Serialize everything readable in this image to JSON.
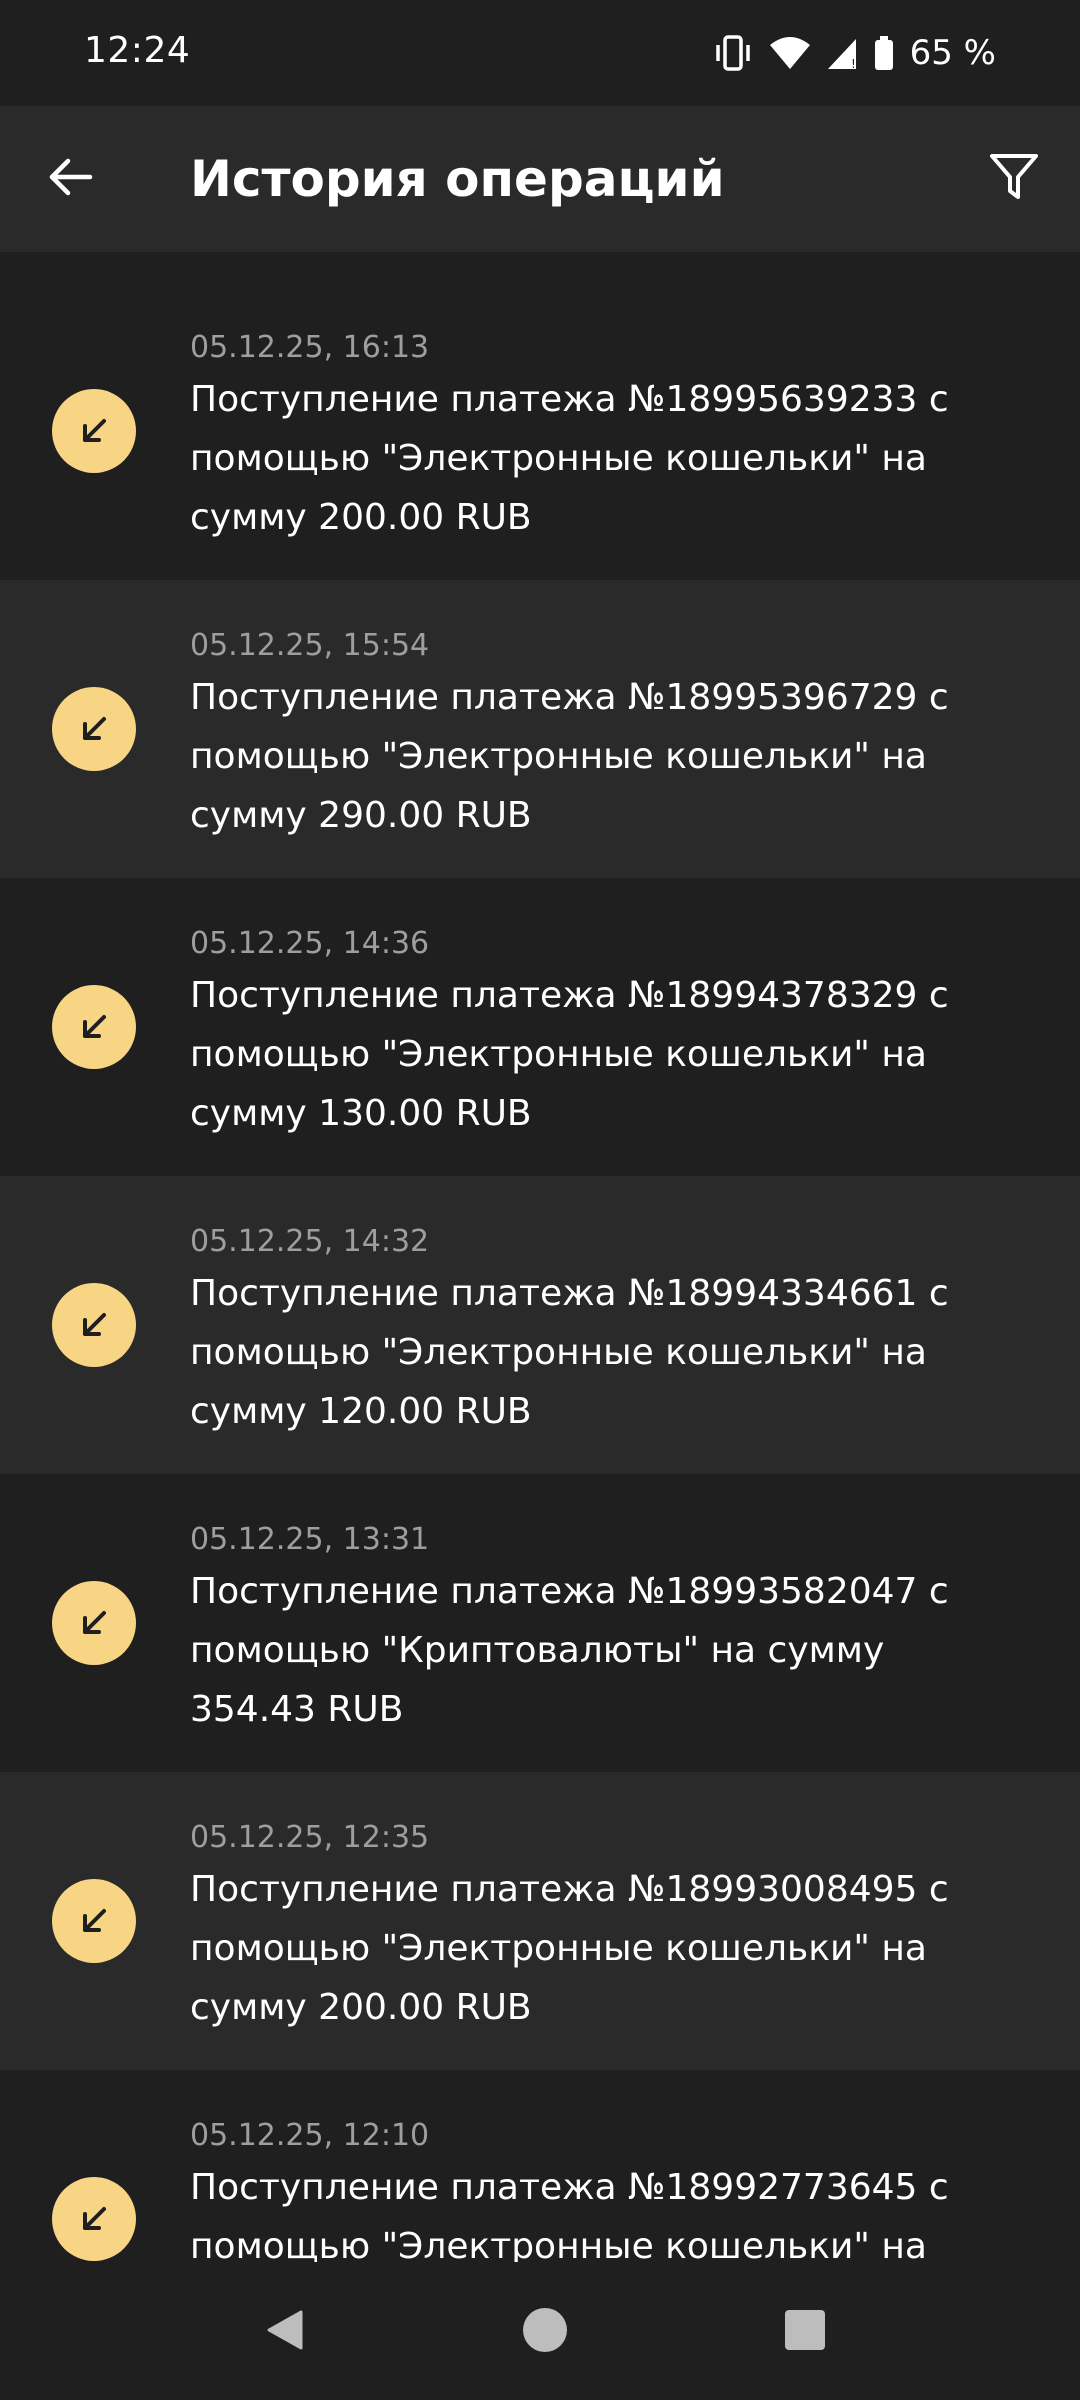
{
  "status_bar": {
    "time": "12:24",
    "battery": "65 %",
    "icons": [
      "vibrate-icon",
      "wifi-icon",
      "signal-icon",
      "battery-icon"
    ]
  },
  "app_bar": {
    "title": "История операций",
    "back_icon": "arrow-left-icon",
    "filter_icon": "filter-icon"
  },
  "colors": {
    "background": "#1f1f1f",
    "row_alt": "#2a2a2a",
    "incoming_badge": "#f8d585",
    "date_text": "#9e9e9e"
  },
  "operations": [
    {
      "date": "05.12.25, 16:13",
      "description": "Поступление платежа №18995639233 с помощью \"Электронные кошельки\" на сумму 200.00 RUB",
      "icon": "incoming-arrow-icon"
    },
    {
      "date": "05.12.25, 15:54",
      "description": "Поступление платежа №18995396729 с помощью \"Электронные кошельки\" на сумму 290.00 RUB",
      "icon": "incoming-arrow-icon"
    },
    {
      "date": "05.12.25, 14:36",
      "description": "Поступление платежа №18994378329 с помощью \"Электронные кошельки\" на сумму 130.00 RUB",
      "icon": "incoming-arrow-icon"
    },
    {
      "date": "05.12.25, 14:32",
      "description": "Поступление платежа №18994334661 с помощью \"Электронные кошельки\" на сумму 120.00 RUB",
      "icon": "incoming-arrow-icon"
    },
    {
      "date": "05.12.25, 13:31",
      "description": "Поступление платежа №18993582047 с помощью \"Криптовалюты\" на сумму 354.43 RUB",
      "icon": "incoming-arrow-icon"
    },
    {
      "date": "05.12.25, 12:35",
      "description": "Поступление платежа №18993008495 с помощью \"Электронные кошельки\" на сумму 200.00 RUB",
      "icon": "incoming-arrow-icon"
    },
    {
      "date": "05.12.25, 12:10",
      "description": "Поступление платежа №18992773645 с помощью \"Электронные кошельки\" на",
      "icon": "incoming-arrow-icon"
    }
  ],
  "nav_bar": {
    "buttons": [
      "back-triangle-icon",
      "home-circle-icon",
      "recents-square-icon"
    ]
  }
}
